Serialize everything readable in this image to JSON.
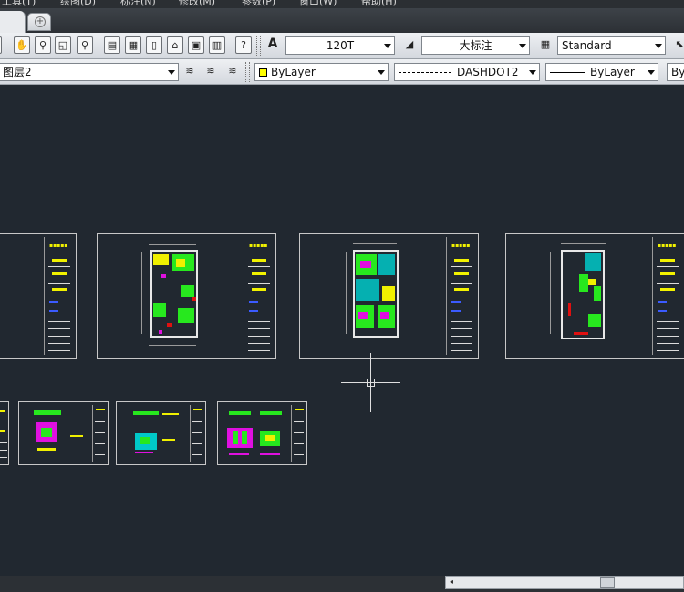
{
  "menu": {
    "items": [
      "工具(T)",
      "绘图(D)",
      "标注(N)",
      "修改(M)",
      "参数(P)",
      "窗口(W)",
      "帮助(H)"
    ]
  },
  "toolbar1": {
    "text_style": "120T",
    "dim_style": "大标注",
    "table_style": "Standard",
    "icons": [
      "pan-icon",
      "zoom-realtime-icon",
      "zoom-window-icon",
      "zoom-previous-icon",
      "properties-icon",
      "design-center-icon",
      "tool-palettes-icon",
      "sheet-set-icon",
      "markup-icon",
      "calculator-icon",
      "help-icon"
    ],
    "help_glyph": "?"
  },
  "toolbar2": {
    "layer": "图层2",
    "color": "ByLayer",
    "linetype": "DASHDOT2",
    "lineweight": "ByLayer",
    "plotstyle_partial": "By"
  },
  "sheets": {
    "top_row_count": 4,
    "bottom_row_count": 4
  },
  "colors": {
    "background": "#212830",
    "accent_yellow": "#f2f200",
    "accent_green": "#27e81e"
  },
  "scrollbar": {
    "left_arrow": "◂"
  }
}
